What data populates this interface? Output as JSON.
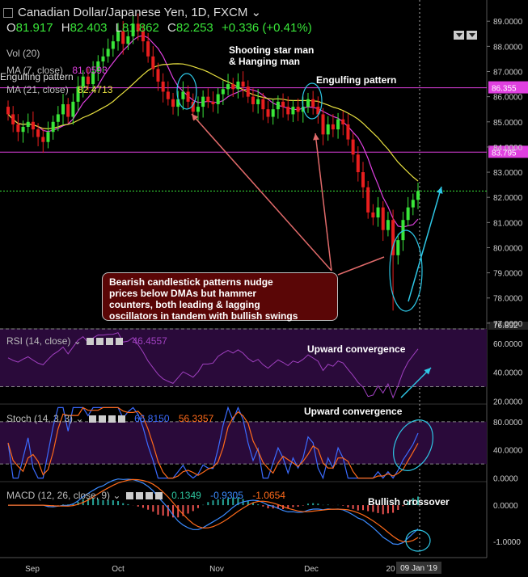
{
  "header": {
    "title": "Canadian Dollar/Japanese Yen, 1D, FXCM",
    "ohlc": [
      {
        "k": "O",
        "v": "81.917"
      },
      {
        "k": "H",
        "v": "82.403"
      },
      {
        "k": "L",
        "v": "81.862"
      },
      {
        "k": "C",
        "v": "82.253"
      }
    ],
    "change": "+0.336 (+0.41%)"
  },
  "indicators": {
    "vol": "Vol (20)",
    "ma7": "MA (7, close)",
    "ma7_value": "81.0593",
    "ma21": "MA (21, close)",
    "ma21_value": "82.4713",
    "engulfing": "Engulfing pattern",
    "rsi": "RSI (14, close)",
    "rsi_value": "46.4557",
    "stoch": "Stoch (14, 3, 3)",
    "stoch_k": "66.8150",
    "stoch_d": "56.3357",
    "macd": "MACD (12, 26, close, 9)",
    "macd_hist": "0.1349",
    "macd_line": "-0.9305",
    "macd_signal": "-1.0654"
  },
  "annotations": {
    "shooting_star": "Shooting star man\n& Hanging man",
    "engulfing": "Engulfing pattern",
    "callout": "Bearish candlestick patterns nudge\nprices below DMAs but hammer\ncounters, both leading & lagging\noscillators in tandem with bullish swings",
    "rsi_note": "Upward convergence",
    "stoch_note": "Upward convergence",
    "macd_note": "Bullish crossover"
  },
  "colors": {
    "up": "#39e639",
    "down": "#e81e1e",
    "ma7": "#e040e0",
    "ma21": "#e8e040",
    "hline": "#e040e0",
    "arrow_red": "#e06a6a",
    "arrow_cyan": "#2ec7e6",
    "rsi": "#a040c0",
    "stoch_k": "#3b6bff",
    "stoch_d": "#ff6a1a",
    "macd_line": "#3b8bff",
    "macd_signal": "#ff6a1a"
  },
  "chart_data": {
    "type": "candlestick",
    "x_ticks": [
      "Sep",
      "Oct",
      "Nov",
      "Dec",
      "20",
      "09 Jan '19"
    ],
    "price_axis": {
      "ticks": [
        "89.0000",
        "88.0000",
        "87.0000",
        "86.0000",
        "85.0000",
        "84.0000",
        "83.0000",
        "82.0000",
        "81.0000",
        "80.0000",
        "79.0000",
        "78.0000",
        "77.0000"
      ],
      "range": [
        76.9,
        89.2
      ],
      "hlines": [
        {
          "value": 86.355,
          "label": "86.355"
        },
        {
          "value": 83.795,
          "label": "83.795"
        }
      ],
      "last": {
        "value": 82.253,
        "label": ""
      },
      "bottom_label": "76.892"
    },
    "closes": [
      85.3,
      84.9,
      84.6,
      84.8,
      85.0,
      84.7,
      84.4,
      84.2,
      84.6,
      85.0,
      85.3,
      85.7,
      85.2,
      85.8,
      86.4,
      86.8,
      86.5,
      87.0,
      87.4,
      87.6,
      87.9,
      88.2,
      88.6,
      88.1,
      88.4,
      88.9,
      88.6,
      88.2,
      87.6,
      87.1,
      86.6,
      86.2,
      85.9,
      85.6,
      85.9,
      86.2,
      85.8,
      85.4,
      85.6,
      86.0,
      85.8,
      85.7,
      86.1,
      86.3,
      86.5,
      86.3,
      86.6,
      86.4,
      86.0,
      85.7,
      85.9,
      85.5,
      85.2,
      85.5,
      85.8,
      85.6,
      85.3,
      85.6,
      85.4,
      85.6,
      85.9,
      85.6,
      85.3,
      84.5,
      84.9,
      84.7,
      85.1,
      84.9,
      84.3,
      83.7,
      83.0,
      82.4,
      81.4,
      81.2,
      81.6,
      80.7,
      81.1,
      79.7,
      80.3,
      81.1,
      81.6,
      81.9,
      82.25
    ],
    "rsi_axis": {
      "ticks": [
        "60.0000",
        "40.0000",
        "20.0000"
      ],
      "range": [
        18,
        70
      ]
    },
    "stoch_axis": {
      "ticks": [
        "80.0000",
        "40.0000",
        "0.0000"
      ],
      "range": [
        -5,
        105
      ]
    },
    "macd_axis": {
      "ticks": [
        "0.0000",
        "-1.0000"
      ],
      "range": [
        -1.45,
        0.65
      ]
    }
  }
}
